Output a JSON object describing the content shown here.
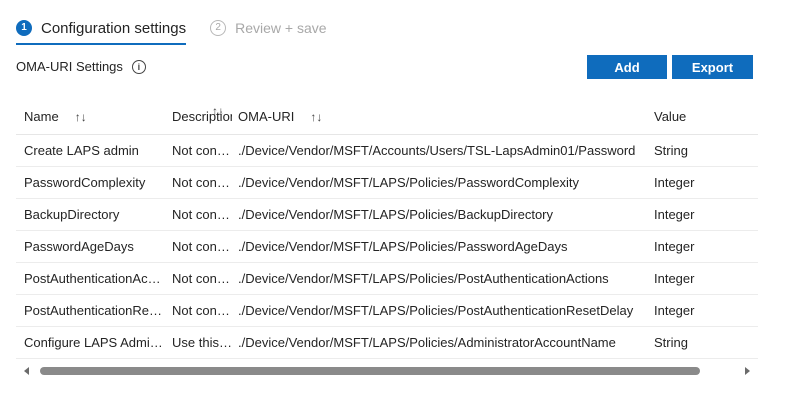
{
  "wizard": {
    "steps": [
      {
        "number": "1",
        "label": "Configuration settings"
      },
      {
        "number": "2",
        "label": "Review + save"
      }
    ]
  },
  "section": {
    "title": "OMA-URI Settings",
    "info_icon": "info-icon"
  },
  "toolbar": {
    "add_label": "Add",
    "export_label": "Export"
  },
  "table": {
    "columns": {
      "name": "Name",
      "description": "Description",
      "oma_uri": "OMA-URI",
      "value": "Value"
    },
    "rows": [
      {
        "name": "Create LAPS admin",
        "description": "Not configured",
        "oma_uri": "./Device/Vendor/MSFT/Accounts/Users/TSL-LapsAdmin01/Password",
        "value": "String"
      },
      {
        "name": "PasswordComplexity",
        "description": "Not configured",
        "oma_uri": "./Device/Vendor/MSFT/LAPS/Policies/PasswordComplexity",
        "value": "Integer"
      },
      {
        "name": "BackupDirectory",
        "description": "Not configured",
        "oma_uri": "./Device/Vendor/MSFT/LAPS/Policies/BackupDirectory",
        "value": "Integer"
      },
      {
        "name": "PasswordAgeDays",
        "description": "Not configured",
        "oma_uri": "./Device/Vendor/MSFT/LAPS/Policies/PasswordAgeDays",
        "value": "Integer"
      },
      {
        "name": "PostAuthenticationActions",
        "description": "Not configured",
        "oma_uri": "./Device/Vendor/MSFT/LAPS/Policies/PostAuthenticationActions",
        "value": "Integer"
      },
      {
        "name": "PostAuthenticationResetDelay",
        "description": "Not configured",
        "oma_uri": "./Device/Vendor/MSFT/LAPS/Policies/PostAuthenticationResetDelay",
        "value": "Integer"
      },
      {
        "name": "Configure LAPS Administrator",
        "description": "Use this setting",
        "oma_uri": "./Device/Vendor/MSFT/LAPS/Policies/AdministratorAccountName",
        "value": "String"
      }
    ]
  },
  "colors": {
    "accent": "#0f6cbd"
  }
}
